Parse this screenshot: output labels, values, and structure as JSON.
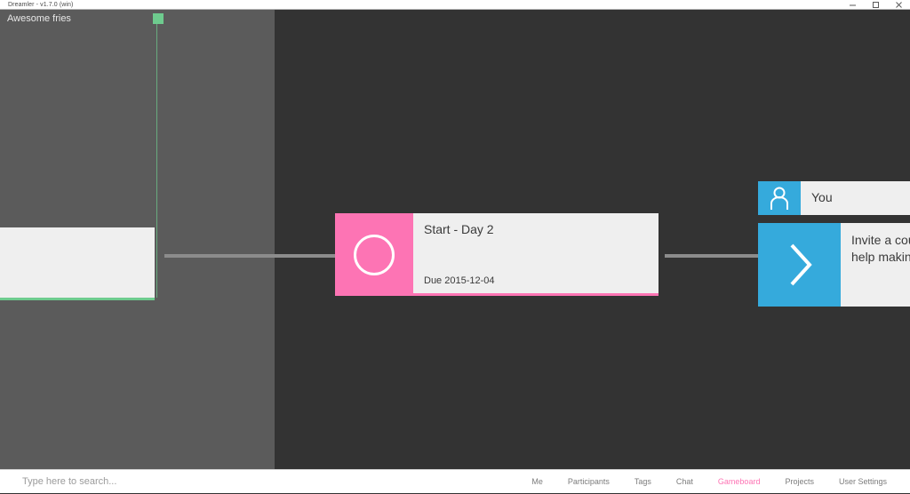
{
  "window": {
    "title": "Dreamler - v1.7.0 (win)",
    "controls": [
      {
        "name": "minimize-button",
        "glyph": "minimize"
      },
      {
        "name": "maximize-button",
        "glyph": "maximize"
      },
      {
        "name": "close-button",
        "glyph": "close"
      }
    ]
  },
  "board": {
    "zone_title": "Awesome fries",
    "colors": {
      "zone_left_bg": "#5b5b5b",
      "canvas_bg": "#333333",
      "milestone_green": "#6ecb8e",
      "task_pink": "#fd74b4",
      "person_blue": "#35aadc",
      "connector": "#8c8c8c"
    },
    "milestone_flag": {
      "label": "",
      "color": "#6ecb8e"
    },
    "cards": [
      {
        "name": "card-offscreen",
        "title": "",
        "accent": "#6ecb8e"
      },
      {
        "name": "card-start",
        "title": "Start - Day 2",
        "due": "Due 2015-12-04",
        "icon": "circle-ring-icon",
        "accent": "#fd74b4"
      },
      {
        "name": "card-you",
        "title": "You",
        "icon": "person-icon",
        "accent": "#35aadc"
      },
      {
        "name": "card-invite",
        "title": "Invite a coup\nhelp making",
        "icon": "chevron-right-icon",
        "accent": "#35aadc"
      }
    ]
  },
  "bottombar": {
    "search_placeholder": "Type here to search...",
    "search_value": "",
    "nav": [
      {
        "label": "Me",
        "active": false
      },
      {
        "label": "Participants",
        "active": false
      },
      {
        "label": "Tags",
        "active": false
      },
      {
        "label": "Chat",
        "active": false
      },
      {
        "label": "Gameboard",
        "active": true
      },
      {
        "label": "Projects",
        "active": false
      },
      {
        "label": "User Settings",
        "active": false
      }
    ]
  }
}
